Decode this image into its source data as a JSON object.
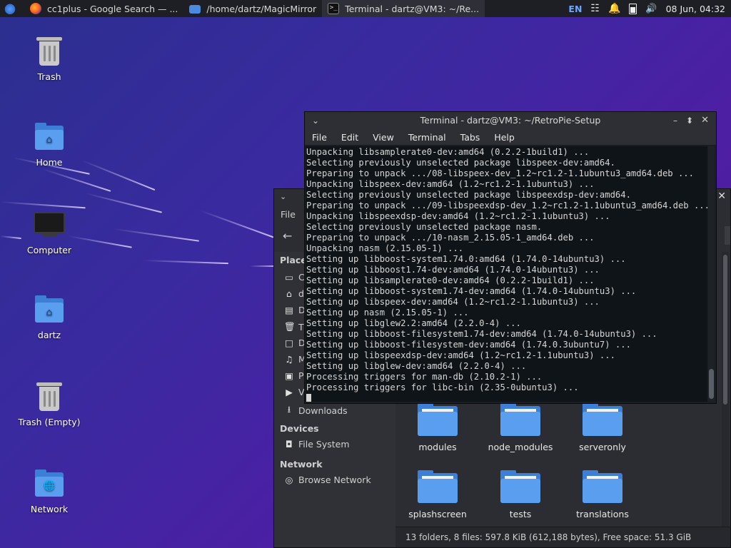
{
  "panel": {
    "tasks": [
      {
        "label": "cc1plus - Google Search — ...",
        "icon": "firefox-icon"
      },
      {
        "label": "/home/dartz/MagicMirror",
        "icon": "folder-icon"
      },
      {
        "label": "Terminal - dartz@VM3: ~/Re...",
        "icon": "terminal-icon"
      }
    ],
    "lang": "EN",
    "clock": "08 Jun, 04:32"
  },
  "desktop": {
    "icons": [
      {
        "label": "Trash"
      },
      {
        "label": "Home"
      },
      {
        "label": "Computer"
      },
      {
        "label": "dartz"
      },
      {
        "label": "Trash (Empty)"
      },
      {
        "label": "Network"
      }
    ]
  },
  "file_manager": {
    "menu_file": "File",
    "sidebar": {
      "places_title": "Places",
      "places": [
        {
          "label": "C",
          "icon": "computer-icon"
        },
        {
          "label": "d",
          "icon": "home-icon"
        },
        {
          "label": "D",
          "icon": "desktop-icon"
        },
        {
          "label": "T",
          "icon": "trash-icon"
        },
        {
          "label": "D",
          "icon": "documents-icon"
        },
        {
          "label": "M",
          "icon": "music-icon"
        },
        {
          "label": "P",
          "icon": "pictures-icon"
        },
        {
          "label": "V",
          "icon": "videos-icon"
        },
        {
          "label": "Downloads",
          "icon": "downloads-icon"
        }
      ],
      "devices_title": "Devices",
      "devices": [
        {
          "label": "File System",
          "icon": "drive-icon"
        }
      ],
      "network_title": "Network",
      "network": [
        {
          "label": "Browse Network",
          "icon": "globe-icon"
        }
      ]
    },
    "folders": [
      {
        "label": "modules"
      },
      {
        "label": "node_modules"
      },
      {
        "label": "serveronly"
      },
      {
        "label": "splashscreen"
      },
      {
        "label": "tests"
      },
      {
        "label": "translations"
      }
    ],
    "status": "13 folders, 8 files: 597.8 KiB (612,188 bytes), Free space: 51.3 GiB"
  },
  "terminal": {
    "title": "Terminal - dartz@VM3: ~/RetroPie-Setup",
    "menu": [
      "File",
      "Edit",
      "View",
      "Terminal",
      "Tabs",
      "Help"
    ],
    "lines": [
      "Unpacking libsamplerate0-dev:amd64 (0.2.2-1build1) ...",
      "Selecting previously unselected package libspeex-dev:amd64.",
      "Preparing to unpack .../08-libspeex-dev_1.2~rc1.2-1.1ubuntu3_amd64.deb ...",
      "Unpacking libspeex-dev:amd64 (1.2~rc1.2-1.1ubuntu3) ...",
      "Selecting previously unselected package libspeexdsp-dev:amd64.",
      "Preparing to unpack .../09-libspeexdsp-dev_1.2~rc1.2-1.1ubuntu3_amd64.deb ...",
      "Unpacking libspeexdsp-dev:amd64 (1.2~rc1.2-1.1ubuntu3) ...",
      "Selecting previously unselected package nasm.",
      "Preparing to unpack .../10-nasm_2.15.05-1_amd64.deb ...",
      "Unpacking nasm (2.15.05-1) ...",
      "Setting up libboost-system1.74.0:amd64 (1.74.0-14ubuntu3) ...",
      "Setting up libboost1.74-dev:amd64 (1.74.0-14ubuntu3) ...",
      "Setting up libsamplerate0-dev:amd64 (0.2.2-1build1) ...",
      "Setting up libboost-system1.74-dev:amd64 (1.74.0-14ubuntu3) ...",
      "Setting up libspeex-dev:amd64 (1.2~rc1.2-1.1ubuntu3) ...",
      "Setting up nasm (2.15.05-1) ...",
      "Setting up libglew2.2:amd64 (2.2.0-4) ...",
      "Setting up libboost-filesystem1.74-dev:amd64 (1.74.0-14ubuntu3) ...",
      "Setting up libboost-filesystem-dev:amd64 (1.74.0.3ubuntu7) ...",
      "Setting up libspeexdsp-dev:amd64 (1.2~rc1.2-1.1ubuntu3) ...",
      "Setting up libglew-dev:amd64 (2.2.0-4) ...",
      "Processing triggers for man-db (2.10.2-1) ...",
      "Processing triggers for libc-bin (2.35-0ubuntu3) ..."
    ]
  }
}
